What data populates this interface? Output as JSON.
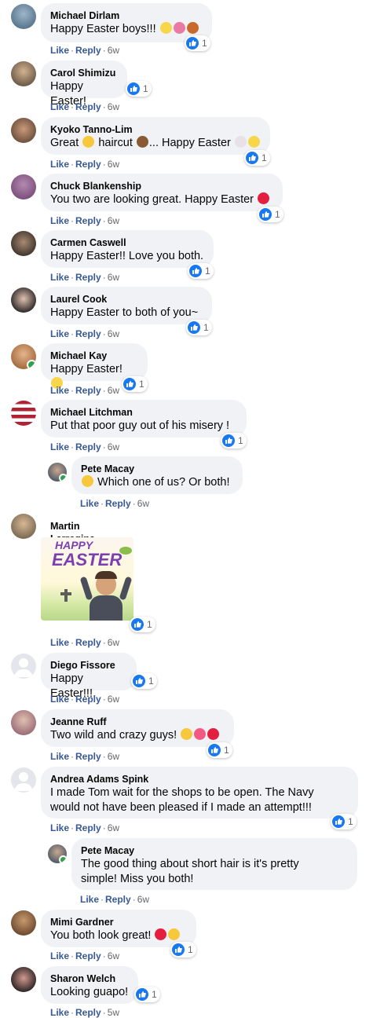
{
  "actions": {
    "like": "Like",
    "reply": "Reply"
  },
  "colors": {
    "like_blue": "#1877f2",
    "action_blue": "#385898",
    "bubble": "#f0f2f5",
    "online": "#31a24c"
  },
  "comments": [
    {
      "author": "Michael Dirlam",
      "text": "Happy Easter boys!!! ",
      "reactions": "1",
      "time": "6w",
      "emoji_icons": [
        "hatching-chick-icon",
        "bouquet-icon",
        "butterfly-icon"
      ]
    },
    {
      "author": "Carol Shimizu",
      "text": "Happy Easter!",
      "reactions": "1",
      "time": "6w"
    },
    {
      "author": "Kyoko Tanno-Lim",
      "text_parts": [
        "Great ",
        " haircut ",
        "... Happy Easter "
      ],
      "reactions": "1",
      "time": "6w",
      "emoji_icons": [
        "thumbs-up-icon",
        "haircut-person-icon",
        "rabbit-face-icon",
        "hatching-chick-icon"
      ]
    },
    {
      "author": "Chuck Blankenship",
      "text": "You two are looking great. Happy Easter ",
      "reactions": "1",
      "time": "6w",
      "emoji_icons": [
        "red-heart-icon"
      ]
    },
    {
      "author": "Carmen Caswell",
      "text": "Happy Easter!! Love you both.",
      "reactions": "1",
      "time": "6w"
    },
    {
      "author": "Laurel Cook",
      "text": "Happy Easter to both of you~",
      "reactions": "1",
      "time": "6w"
    },
    {
      "author": "Michael Kay",
      "text": "Happy Easter! ",
      "reactions": "1",
      "time": "6w",
      "emoji_icons": [
        "hatching-chick-icon"
      ]
    },
    {
      "author": "Michael Litchman",
      "text": "Put that poor guy out of his misery !",
      "reactions": "1",
      "time": "6w"
    },
    {
      "author": "Pete Macay",
      "text": " Which one of us? Or both!",
      "time": "6w",
      "emoji_icons": [
        "rolling-laughing-icon"
      ]
    },
    {
      "author": "Martin Larregina",
      "sticker_text_1": "HAPPY",
      "sticker_text_2": "EASTER",
      "reactions": "1",
      "time": "6w"
    },
    {
      "author": "Diego Fissore",
      "text": "Happy Easter!!!",
      "reactions": "1",
      "time": "6w"
    },
    {
      "author": "Jeanne Ruff",
      "text": "Two wild and crazy guys! ",
      "reactions": "1",
      "time": "6w",
      "emoji_icons": [
        "grinning-face-icon",
        "two-hearts-icon",
        "red-heart-icon"
      ]
    },
    {
      "author": "Andrea Adams Spink",
      "text": "I made Tom wait for the shops to be open. The Navy\nwould not have been pleased if I made an attempt!!!",
      "reactions": "1",
      "time": "6w"
    },
    {
      "author": "Pete Macay",
      "text": "The good thing about short hair is it's pretty\nsimple! Miss you both!",
      "time": "6w"
    },
    {
      "author": "Mimi Gardner",
      "text": "You both look great! ",
      "reactions": "1",
      "time": "6w",
      "emoji_icons": [
        "red-heart-icon",
        "thumbs-up-icon"
      ]
    },
    {
      "author": "Sharon Welch",
      "text": "Looking guapo!",
      "reactions": "1",
      "time": "5w"
    }
  ]
}
